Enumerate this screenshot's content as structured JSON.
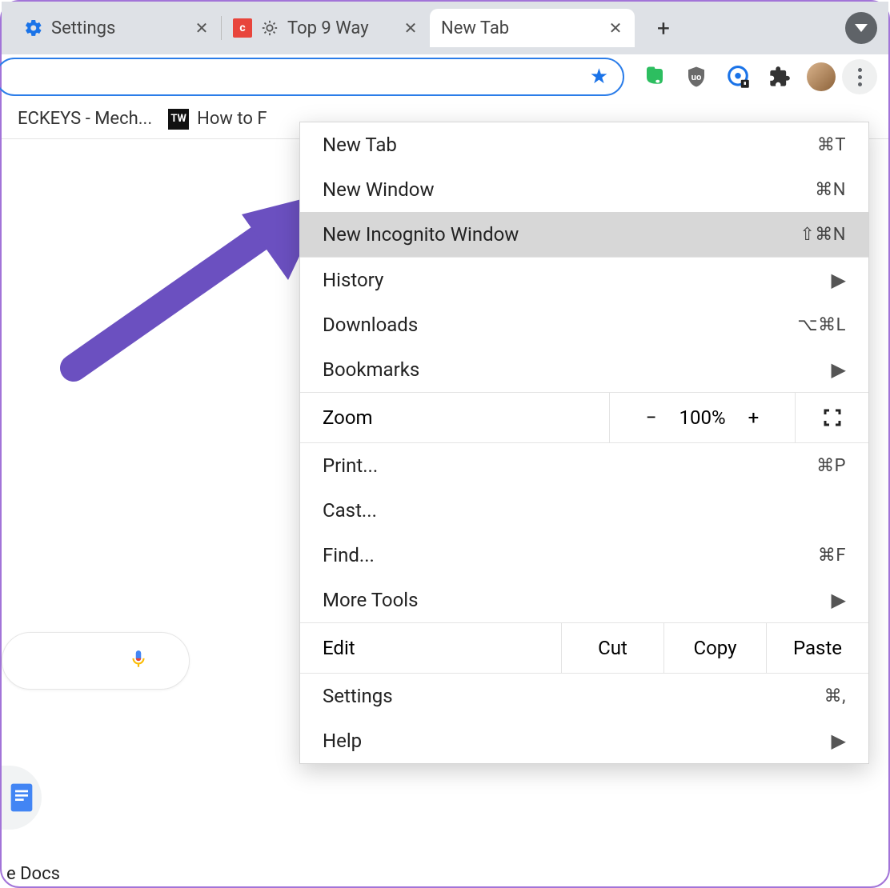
{
  "tabs": [
    {
      "title": "Settings"
    },
    {
      "title": "Top 9 Way"
    },
    {
      "title": "New Tab"
    }
  ],
  "bookmarks": [
    {
      "title": "ECKEYS - Mech..."
    },
    {
      "title": "How to F"
    }
  ],
  "menu": {
    "new_tab": {
      "label": "New Tab",
      "shortcut": "⌘T"
    },
    "new_window": {
      "label": "New Window",
      "shortcut": "⌘N"
    },
    "new_incognito": {
      "label": "New Incognito Window",
      "shortcut": "⇧⌘N"
    },
    "history": {
      "label": "History"
    },
    "downloads": {
      "label": "Downloads",
      "shortcut": "⌥⌘L"
    },
    "bookmarks": {
      "label": "Bookmarks"
    },
    "zoom": {
      "label": "Zoom",
      "value": "100%"
    },
    "print": {
      "label": "Print...",
      "shortcut": "⌘P"
    },
    "cast": {
      "label": "Cast..."
    },
    "find": {
      "label": "Find...",
      "shortcut": "⌘F"
    },
    "more_tools": {
      "label": "More Tools"
    },
    "edit": {
      "label": "Edit",
      "cut": "Cut",
      "copy": "Copy",
      "paste": "Paste"
    },
    "settings": {
      "label": "Settings",
      "shortcut": "⌘,"
    },
    "help": {
      "label": "Help"
    }
  },
  "content": {
    "docs_text": "e Docs"
  }
}
